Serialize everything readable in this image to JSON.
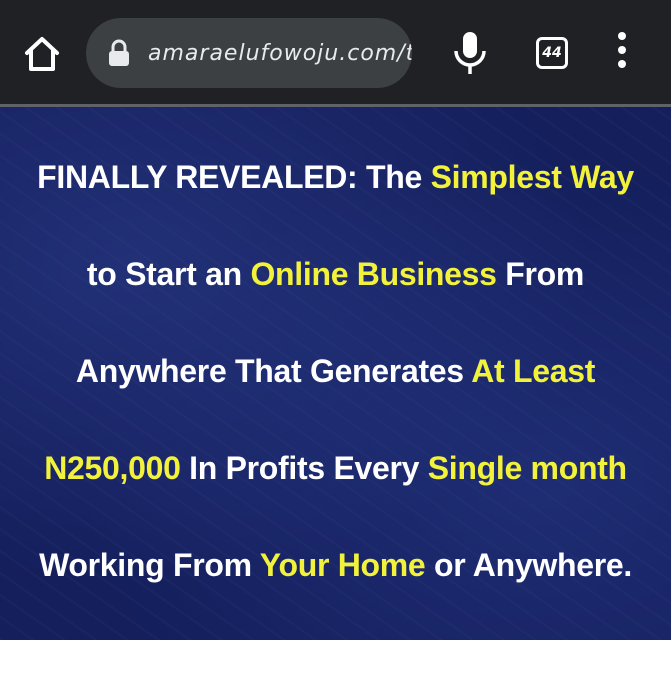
{
  "browser": {
    "url": "amaraelufowoju.com/tr",
    "tab_count": "44"
  },
  "headline": {
    "line1": {
      "a": "FINALLY REVEALED: The ",
      "b": "Simplest Way"
    },
    "line2": {
      "a": "to Start an ",
      "b": "Online Business",
      "c": " From"
    },
    "line3": {
      "a": "Anywhere That Generates ",
      "b": "At Least"
    },
    "line4": {
      "a": "N250,000",
      "b": " In Profits Every ",
      "c": "Single month"
    },
    "line5": {
      "a": "Working From ",
      "b": "Your Home",
      "c": " or Anywhere."
    }
  },
  "colors": {
    "hero_background": "#141f5c",
    "highlight": "#f2f23a",
    "text": "#ffffff",
    "browser_bar": "#202124"
  }
}
